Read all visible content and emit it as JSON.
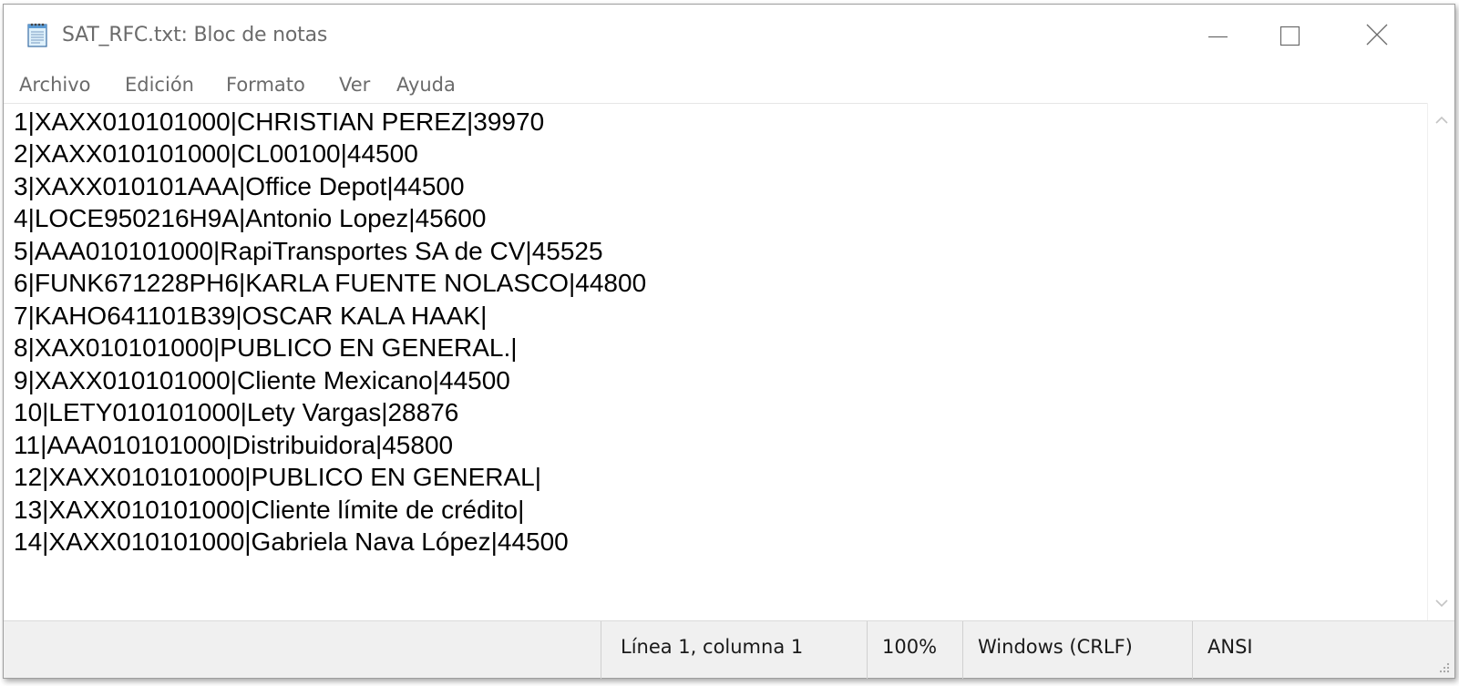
{
  "window": {
    "title": "SAT_RFC.txt: Bloc de notas",
    "app_icon": "notepad-icon"
  },
  "menu": {
    "archivo": "Archivo",
    "edicion": "Edición",
    "formato": "Formato",
    "ver": "Ver",
    "ayuda": "Ayuda"
  },
  "editor": {
    "lines": [
      "1|XAXX010101000|CHRISTIAN PEREZ|39970",
      "2|XAXX010101000|CL00100|44500",
      "3|XAXX010101AAA|Office Depot|44500",
      "4|LOCE950216H9A|Antonio Lopez|45600",
      "5|AAA010101000|RapiTransportes SA de CV|45525",
      "6|FUNK671228PH6|KARLA FUENTE NOLASCO|44800",
      "7|KAHO641101B39|OSCAR KALA HAAK|",
      "8|XAX010101000|PUBLICO EN GENERAL.|",
      "9|XAXX010101000|Cliente Mexicano|44500",
      "10|LETY010101000|Lety Vargas|28876",
      "11|AAA010101000|Distribuidora|45800",
      "12|XAXX010101000|PUBLICO EN GENERAL|",
      "13|XAXX010101000|Cliente límite de crédito|",
      "14|XAXX010101000|Gabriela Nava López|44500"
    ]
  },
  "status": {
    "position": "Línea 1, columna 1",
    "zoom": "100%",
    "line_endings": "Windows (CRLF)",
    "encoding": "ANSI"
  },
  "colors": {
    "chrome_text": "#6b6b6b",
    "statusbar_bg": "#f0f0f0",
    "editor_text": "#000000"
  }
}
